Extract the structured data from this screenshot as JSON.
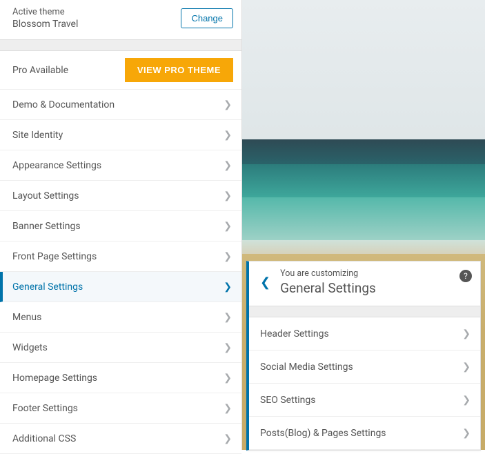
{
  "theme": {
    "active_label": "Active theme",
    "name": "Blossom Travel",
    "change_label": "Change"
  },
  "pro": {
    "label": "Pro Available",
    "button": "VIEW PRO THEME"
  },
  "menu": [
    {
      "label": "Demo & Documentation"
    },
    {
      "label": "Site Identity"
    },
    {
      "label": "Appearance Settings"
    },
    {
      "label": "Layout Settings"
    },
    {
      "label": "Banner Settings"
    },
    {
      "label": "Front Page Settings"
    },
    {
      "label": "General Settings"
    },
    {
      "label": "Menus"
    },
    {
      "label": "Widgets"
    },
    {
      "label": "Homepage Settings"
    },
    {
      "label": "Footer Settings"
    },
    {
      "label": "Additional CSS"
    }
  ],
  "subpanel": {
    "crumb": "You are customizing",
    "title": "General Settings",
    "items": [
      {
        "label": "Header Settings"
      },
      {
        "label": "Social Media Settings"
      },
      {
        "label": "SEO Settings"
      },
      {
        "label": "Posts(Blog) & Pages Settings"
      }
    ]
  }
}
